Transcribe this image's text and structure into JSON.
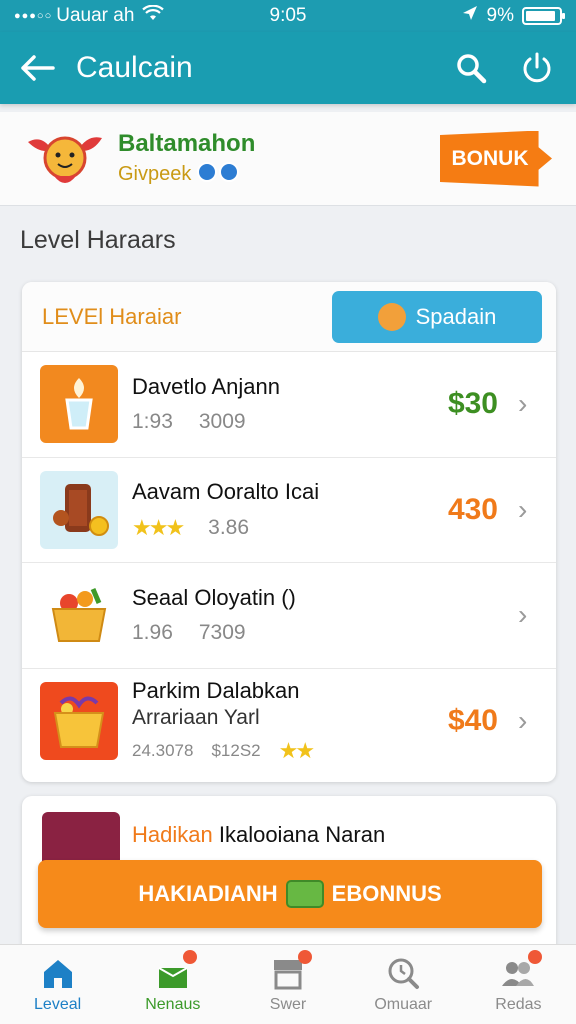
{
  "status_bar": {
    "carrier": "Uauar ah",
    "time": "9:05",
    "battery": "9%",
    "battery_level": 0.9
  },
  "app_bar": {
    "title": "Caulcain"
  },
  "promo": {
    "title": "Baltamahon",
    "subtitle": "Givpeek",
    "bonus_label": "BONUK"
  },
  "section_title": "Level Haraars",
  "card": {
    "header_title": "LEVEl Haraiar",
    "header_button": "Spadain",
    "rows": [
      {
        "name": "Davetlo Anjann",
        "meta1": "1:93",
        "meta2": "3009",
        "price": "$30",
        "price_color": "#3d8f22"
      },
      {
        "name": "Aavam Ooralto Icai",
        "meta1": "",
        "meta2": "3.86",
        "price": "430",
        "price_color": "#f07a1a"
      },
      {
        "name": "Seaal Oloyatin ()",
        "meta1": "1.96",
        "meta2": "7309",
        "price": "",
        "price_color": "#f07a1a"
      },
      {
        "name": "Parkim Dalabkan",
        "name2": "Arrariaan Yarl",
        "meta1": "24.3078",
        "meta2": "$12S2",
        "price": "$40",
        "price_color": "#f07a1a"
      }
    ]
  },
  "card2": {
    "title_accent": "Hadikan",
    "title_rest": "Ikalooiana Naran"
  },
  "cta": {
    "label_left": "HAKIADIANH",
    "label_right": "EBONNUS"
  },
  "tabs": [
    {
      "label": "Leveal"
    },
    {
      "label": "Nenaus"
    },
    {
      "label": "Swer"
    },
    {
      "label": "Omuaar"
    },
    {
      "label": "Redas"
    }
  ]
}
